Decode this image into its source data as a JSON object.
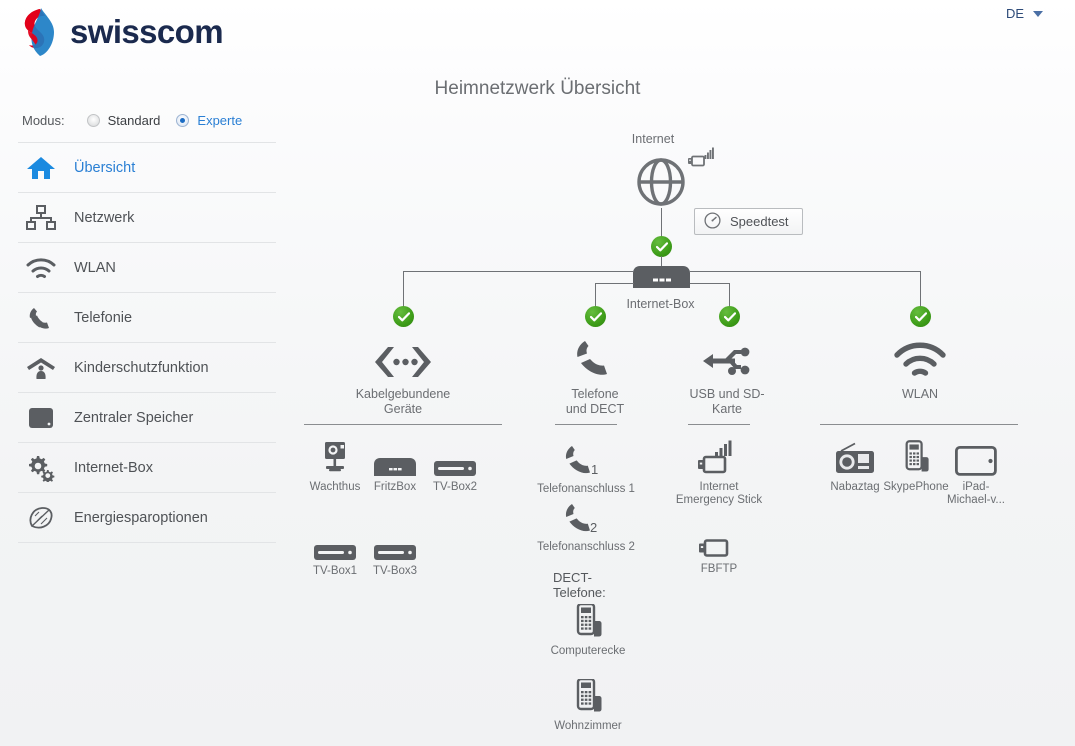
{
  "brand": {
    "name": "swisscom",
    "logo_icon": "swisscom-lifeform-logo"
  },
  "header": {
    "language": "DE",
    "language_caret_icon": "chevron-down-icon"
  },
  "sidebar": {
    "modus_label": "Modus:",
    "modes": [
      {
        "label": "Standard",
        "selected": false
      },
      {
        "label": "Experte",
        "selected": true
      }
    ],
    "items": [
      {
        "label": "Übersicht",
        "icon": "home-icon",
        "active": true
      },
      {
        "label": "Netzwerk",
        "icon": "network-icon",
        "active": false
      },
      {
        "label": "WLAN",
        "icon": "wifi-icon",
        "active": false
      },
      {
        "label": "Telefonie",
        "icon": "phone-handset-icon",
        "active": false
      },
      {
        "label": "Kinderschutzfunktion",
        "icon": "parental-control-icon",
        "active": false
      },
      {
        "label": "Zentraler Speicher",
        "icon": "storage-icon",
        "active": false
      },
      {
        "label": "Internet-Box",
        "icon": "gears-icon",
        "active": false
      },
      {
        "label": "Energiesparoptionen",
        "icon": "leaf-icon",
        "active": false
      }
    ]
  },
  "main": {
    "title": "Heimnetzwerk Übersicht",
    "internet": {
      "label": "Internet",
      "globe_icon": "globe-icon",
      "signal_stick_icon": "usb-signal-icon",
      "status": "ok"
    },
    "speedtest": {
      "label": "Speedtest",
      "icon": "speedometer-icon"
    },
    "router": {
      "label": "Internet-Box",
      "icon": "router-icon"
    },
    "categories": [
      {
        "label_line1": "Kabelgebundene",
        "label_line2": "Geräte",
        "icon": "ethernet-arrows-icon",
        "status": "ok",
        "devices": [
          {
            "label": "Wachthus",
            "icon": "camera-icon"
          },
          {
            "label": "FritzBox",
            "icon": "modem-icon"
          },
          {
            "label": "TV-Box2",
            "icon": "tvbox-icon"
          },
          {
            "label": "TV-Box1",
            "icon": "tvbox-icon"
          },
          {
            "label": "TV-Box3",
            "icon": "tvbox-icon"
          }
        ]
      },
      {
        "label_line1": "Telefone",
        "label_line2": "und DECT",
        "icon": "phone-handset-icon",
        "status": "ok",
        "devices": [
          {
            "label": "Telefonanschluss 1",
            "icon": "phone-port-1-icon"
          },
          {
            "label": "Telefonanschluss 2",
            "icon": "phone-port-2-icon"
          }
        ],
        "subsection_label": "DECT-Telefone:",
        "dect_devices": [
          {
            "label": "Computerecke",
            "icon": "dect-phone-icon"
          },
          {
            "label": "Wohnzimmer",
            "icon": "dect-phone-icon"
          }
        ]
      },
      {
        "label_line1": "USB und SD-",
        "label_line2": "Karte",
        "icon": "usb-icon",
        "status": "ok",
        "devices": [
          {
            "label_line1": "Internet",
            "label_line2": "Emergency Stick",
            "icon": "usb-signal-icon"
          },
          {
            "label_line1": "FBFTP",
            "label_line2": "",
            "icon": "usb-stick-icon"
          }
        ]
      },
      {
        "label_line1": "WLAN",
        "label_line2": "",
        "icon": "wifi-icon",
        "status": "ok",
        "devices": [
          {
            "label_line1": "Nabaztag",
            "label_line2": "",
            "icon": "radio-icon"
          },
          {
            "label_line1": "SkypePhone",
            "label_line2": "",
            "icon": "dect-phone-icon"
          },
          {
            "label_line1": "iPad-",
            "label_line2": "Michael-v...",
            "icon": "tablet-icon"
          }
        ]
      }
    ]
  },
  "colors": {
    "accent_blue": "#2a7fd4",
    "status_green": "#3d9c18",
    "text_gray": "#6b6e72",
    "logo_navy": "#1b2a4e"
  }
}
